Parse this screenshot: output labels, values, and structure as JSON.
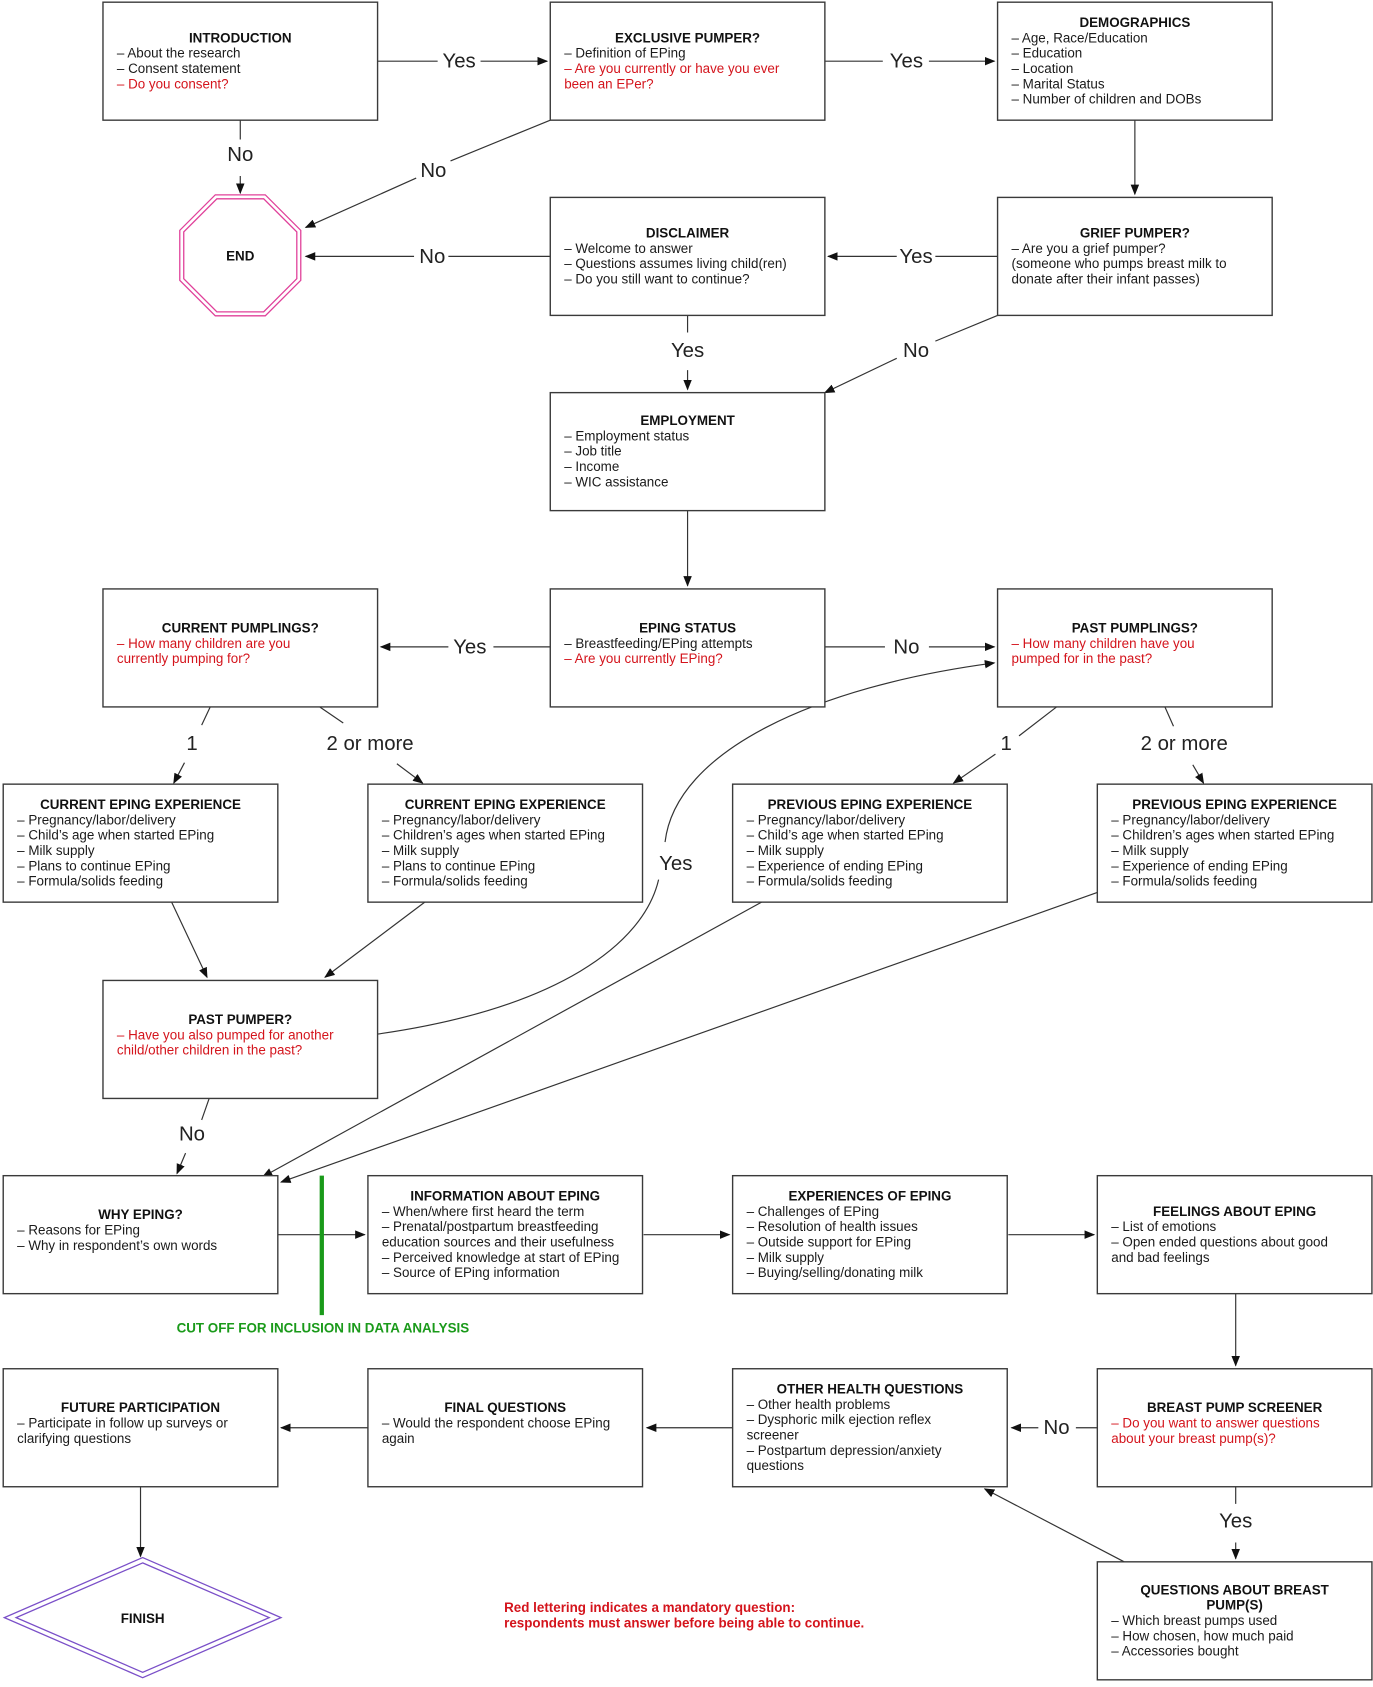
{
  "colors": {
    "required_text": "#d4141c",
    "normal_text": "#1a1a1a",
    "end_border": "#e0409a",
    "finish_border": "#7a4fc8",
    "cutoff_line": "#1a9a1a"
  },
  "nodes": {
    "introduction": {
      "title": "INTRODUCTION",
      "lines": [
        {
          "text": "– About the research",
          "required": false
        },
        {
          "text": "– Consent statement",
          "required": false
        },
        {
          "text": "– Do you consent?",
          "required": true
        }
      ]
    },
    "exclusive_pumper": {
      "title": "EXCLUSIVE PUMPER?",
      "lines": [
        {
          "text": "– Definition of EPing",
          "required": false
        },
        {
          "text": "– Are you currently or have you ever",
          "required": true
        },
        {
          "text": "been an EPer?",
          "required": true
        }
      ]
    },
    "demographics": {
      "title": "DEMOGRAPHICS",
      "lines": [
        {
          "text": "– Age, Race/Education",
          "required": false
        },
        {
          "text": "– Education",
          "required": false
        },
        {
          "text": "– Location",
          "required": false
        },
        {
          "text": "– Marital Status",
          "required": false
        },
        {
          "text": "– Number of children and DOBs",
          "required": false
        }
      ]
    },
    "disclaimer": {
      "title": "DISCLAIMER",
      "lines": [
        {
          "text": "– Welcome to answer",
          "required": false
        },
        {
          "text": "– Questions assumes living child(ren)",
          "required": false
        },
        {
          "text": "– Do you still want to continue?",
          "required": false
        }
      ]
    },
    "grief_pumper": {
      "title": "GRIEF PUMPER?",
      "lines": [
        {
          "text": "– Are you a grief pumper?",
          "required": false
        },
        {
          "text": "(someone who pumps breast milk to",
          "required": false
        },
        {
          "text": "donate after their infant passes)",
          "required": false
        }
      ]
    },
    "employment": {
      "title": "EMPLOYMENT",
      "lines": [
        {
          "text": "– Employment status",
          "required": false
        },
        {
          "text": "– Job title",
          "required": false
        },
        {
          "text": "– Income",
          "required": false
        },
        {
          "text": "– WIC assistance",
          "required": false
        }
      ]
    },
    "current_pumplings": {
      "title": "CURRENT PUMPLINGS?",
      "lines": [
        {
          "text": "– How many children are you",
          "required": true
        },
        {
          "text": "currently pumping for?",
          "required": true
        }
      ]
    },
    "eping_status": {
      "title": "EPING STATUS",
      "lines": [
        {
          "text": "– Breastfeeding/EPing attempts",
          "required": false
        },
        {
          "text": "– Are you currently EPing?",
          "required": true
        }
      ]
    },
    "past_pumplings": {
      "title": "PAST PUMPLINGS?",
      "lines": [
        {
          "text": "– How many children have you",
          "required": true
        },
        {
          "text": "pumped for in the past?",
          "required": true
        }
      ]
    },
    "current_exp_one": {
      "title": "CURRENT EPING EXPERIENCE",
      "lines": [
        {
          "text": "– Pregnancy/labor/delivery",
          "required": false
        },
        {
          "text": "– Child’s age when started EPing",
          "required": false
        },
        {
          "text": "– Milk supply",
          "required": false
        },
        {
          "text": "– Plans to continue EPing",
          "required": false
        },
        {
          "text": "– Formula/solids feeding",
          "required": false
        }
      ]
    },
    "current_exp_multi": {
      "title": "CURRENT EPING EXPERIENCE",
      "lines": [
        {
          "text": "– Pregnancy/labor/delivery",
          "required": false
        },
        {
          "text": "– Children’s ages when started EPing",
          "required": false
        },
        {
          "text": "– Milk supply",
          "required": false
        },
        {
          "text": "– Plans to continue EPing",
          "required": false
        },
        {
          "text": "– Formula/solids feeding",
          "required": false
        }
      ]
    },
    "previous_exp_one": {
      "title": "PREVIOUS EPING EXPERIENCE",
      "lines": [
        {
          "text": "– Pregnancy/labor/delivery",
          "required": false
        },
        {
          "text": "– Child’s age when started EPing",
          "required": false
        },
        {
          "text": "– Milk supply",
          "required": false
        },
        {
          "text": "– Experience of ending EPing",
          "required": false
        },
        {
          "text": "– Formula/solids feeding",
          "required": false
        }
      ]
    },
    "previous_exp_multi": {
      "title": "PREVIOUS EPING EXPERIENCE",
      "lines": [
        {
          "text": "– Pregnancy/labor/delivery",
          "required": false
        },
        {
          "text": "– Children’s ages when started EPing",
          "required": false
        },
        {
          "text": "– Milk supply",
          "required": false
        },
        {
          "text": "– Experience of ending EPing",
          "required": false
        },
        {
          "text": "– Formula/solids feeding",
          "required": false
        }
      ]
    },
    "past_pumper": {
      "title": "PAST PUMPER?",
      "lines": [
        {
          "text": "– Have you also pumped for another",
          "required": true
        },
        {
          "text": "child/other children in the past?",
          "required": true
        }
      ]
    },
    "why_eping": {
      "title": "WHY EPING?",
      "lines": [
        {
          "text": "– Reasons for EPing",
          "required": false
        },
        {
          "text": "– Why in respondent’s own words",
          "required": false
        }
      ]
    },
    "info_about_eping": {
      "title": "INFORMATION ABOUT EPING",
      "lines": [
        {
          "text": "– When/where first heard the term",
          "required": false
        },
        {
          "text": "– Prenatal/postpartum breastfeeding",
          "required": false
        },
        {
          "text": "education sources and their usefulness",
          "required": false
        },
        {
          "text": "– Perceived knowledge at start of EPing",
          "required": false
        },
        {
          "text": "– Source of EPing information",
          "required": false
        }
      ]
    },
    "experiences_of_eping": {
      "title": "EXPERIENCES OF EPING",
      "lines": [
        {
          "text": "– Challenges of EPing",
          "required": false
        },
        {
          "text": "– Resolution of health issues",
          "required": false
        },
        {
          "text": "– Outside support for EPing",
          "required": false
        },
        {
          "text": "– Milk supply",
          "required": false
        },
        {
          "text": "– Buying/selling/donating milk",
          "required": false
        }
      ]
    },
    "feelings_about_eping": {
      "title": "FEELINGS ABOUT EPING",
      "lines": [
        {
          "text": "– List of emotions",
          "required": false
        },
        {
          "text": "– Open ended questions about good",
          "required": false
        },
        {
          "text": "and bad feelings",
          "required": false
        }
      ]
    },
    "future_participation": {
      "title": "FUTURE PARTICIPATION",
      "lines": [
        {
          "text": "– Participate in follow up surveys or",
          "required": false
        },
        {
          "text": "clarifying questions",
          "required": false
        }
      ]
    },
    "final_questions": {
      "title": "FINAL QUESTIONS",
      "lines": [
        {
          "text": "– Would the respondent choose EPing",
          "required": false
        },
        {
          "text": "again",
          "required": false
        }
      ]
    },
    "other_health": {
      "title": "OTHER HEALTH QUESTIONS",
      "lines": [
        {
          "text": "– Other health problems",
          "required": false
        },
        {
          "text": "– Dysphoric milk ejection reflex",
          "required": false
        },
        {
          "text": "screener",
          "required": false
        },
        {
          "text": "– Postpartum depression/anxiety",
          "required": false
        },
        {
          "text": "questions",
          "required": false
        }
      ]
    },
    "pump_screener": {
      "title": "BREAST PUMP SCREENER",
      "lines": [
        {
          "text": "– Do you want to answer questions",
          "required": true
        },
        {
          "text": "about your breast pump(s)?",
          "required": true
        }
      ]
    },
    "pump_questions": {
      "title": "QUESTIONS ABOUT BREAST\nPUMP(S)",
      "lines": [
        {
          "text": "– Which breast pumps used",
          "required": false
        },
        {
          "text": "– How chosen, how much paid",
          "required": false
        },
        {
          "text": "– Accessories bought",
          "required": false
        }
      ]
    }
  },
  "terminals": {
    "end": "END",
    "finish": "FINISH"
  },
  "edge_labels": {
    "intro_yes": "Yes",
    "intro_no": "No",
    "exclusive_yes": "Yes",
    "exclusive_no": "No",
    "disclaimer_no": "No",
    "disclaimer_yes": "Yes",
    "grief_yes": "Yes",
    "grief_no": "No",
    "status_yes": "Yes",
    "status_no": "No",
    "current_one": "1",
    "current_multi": "2 or more",
    "past_one": "1",
    "past_multi": "2 or more",
    "past_pumper_yes": "Yes",
    "past_pumper_no": "No",
    "screener_no": "No",
    "screener_yes": "Yes"
  },
  "cutoff_label": "CUT OFF FOR INCLUSION IN DATA ANALYSIS",
  "legend_note": [
    "Red lettering indicates a mandatory question:",
    "respondents must answer before being able to continue."
  ]
}
